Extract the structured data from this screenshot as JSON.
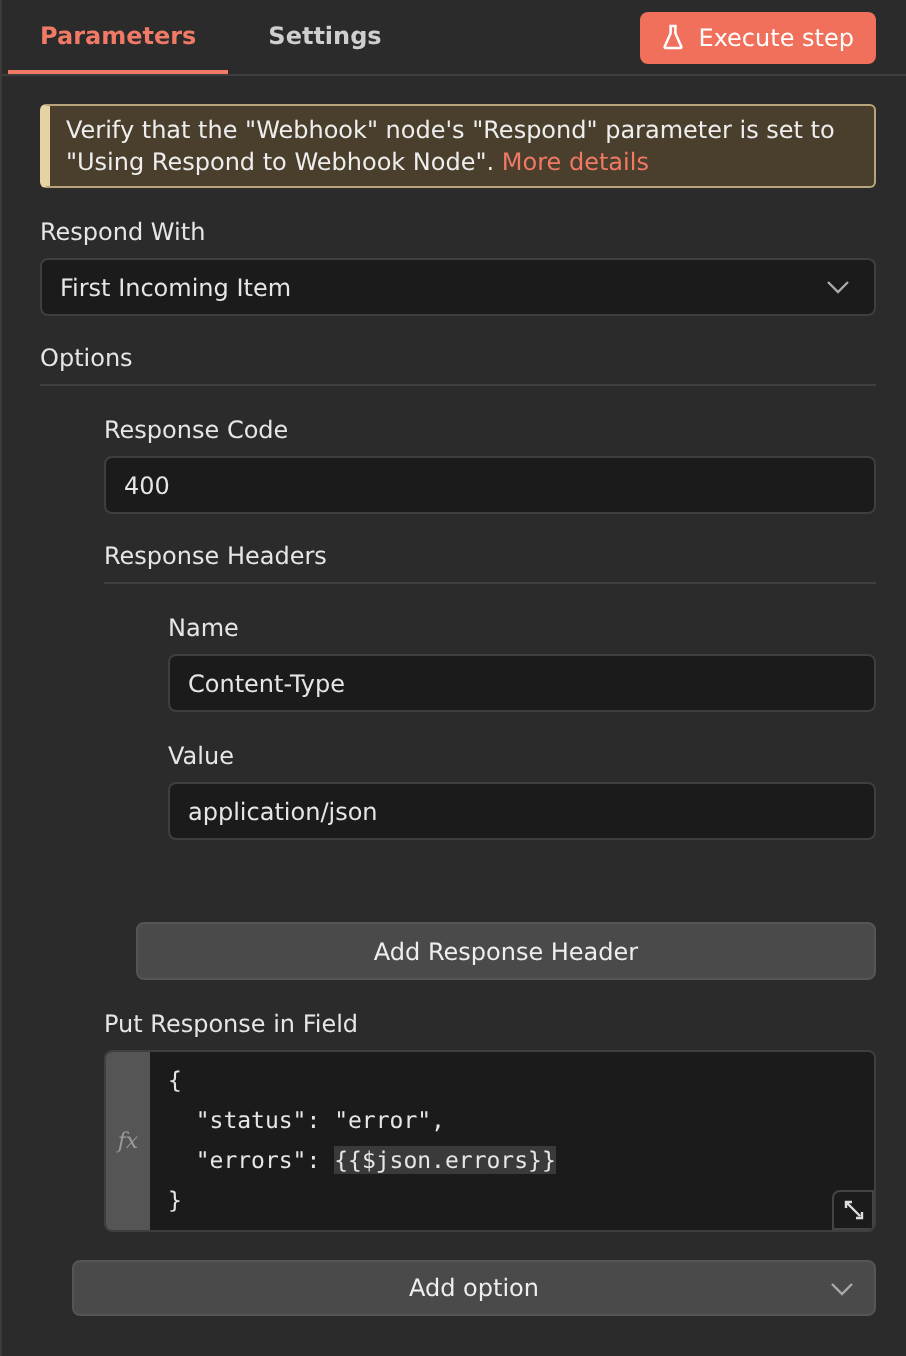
{
  "tabs": [
    {
      "label": "Parameters",
      "selected": true
    },
    {
      "label": "Settings",
      "selected": false
    }
  ],
  "execute_button": {
    "label": "Execute step"
  },
  "notice": {
    "text": "Verify that the \"Webhook\" node's \"Respond\" parameter is set to \"Using Respond to Webhook Node\".",
    "link": "More details"
  },
  "respond_with": {
    "label": "Respond With",
    "value": "First Incoming Item"
  },
  "options": {
    "label": "Options",
    "response_code": {
      "label": "Response Code",
      "value": "400"
    },
    "response_headers": {
      "label": "Response Headers",
      "fields": [
        {
          "label": "Name",
          "value": "Content-Type"
        },
        {
          "label": "Value",
          "value": "application/json"
        }
      ],
      "add_button": "Add Response Header"
    },
    "put_response_in_field": {
      "label": "Put Response in Field",
      "fx": "fx",
      "lines": [
        {
          "text": "{"
        },
        {
          "text": "  \"status\": \"error\","
        },
        {
          "text": "  \"errors\": ",
          "expression": "{{$json.errors}}"
        },
        {
          "text": "}"
        }
      ]
    }
  },
  "add_option": {
    "label": "Add option"
  }
}
